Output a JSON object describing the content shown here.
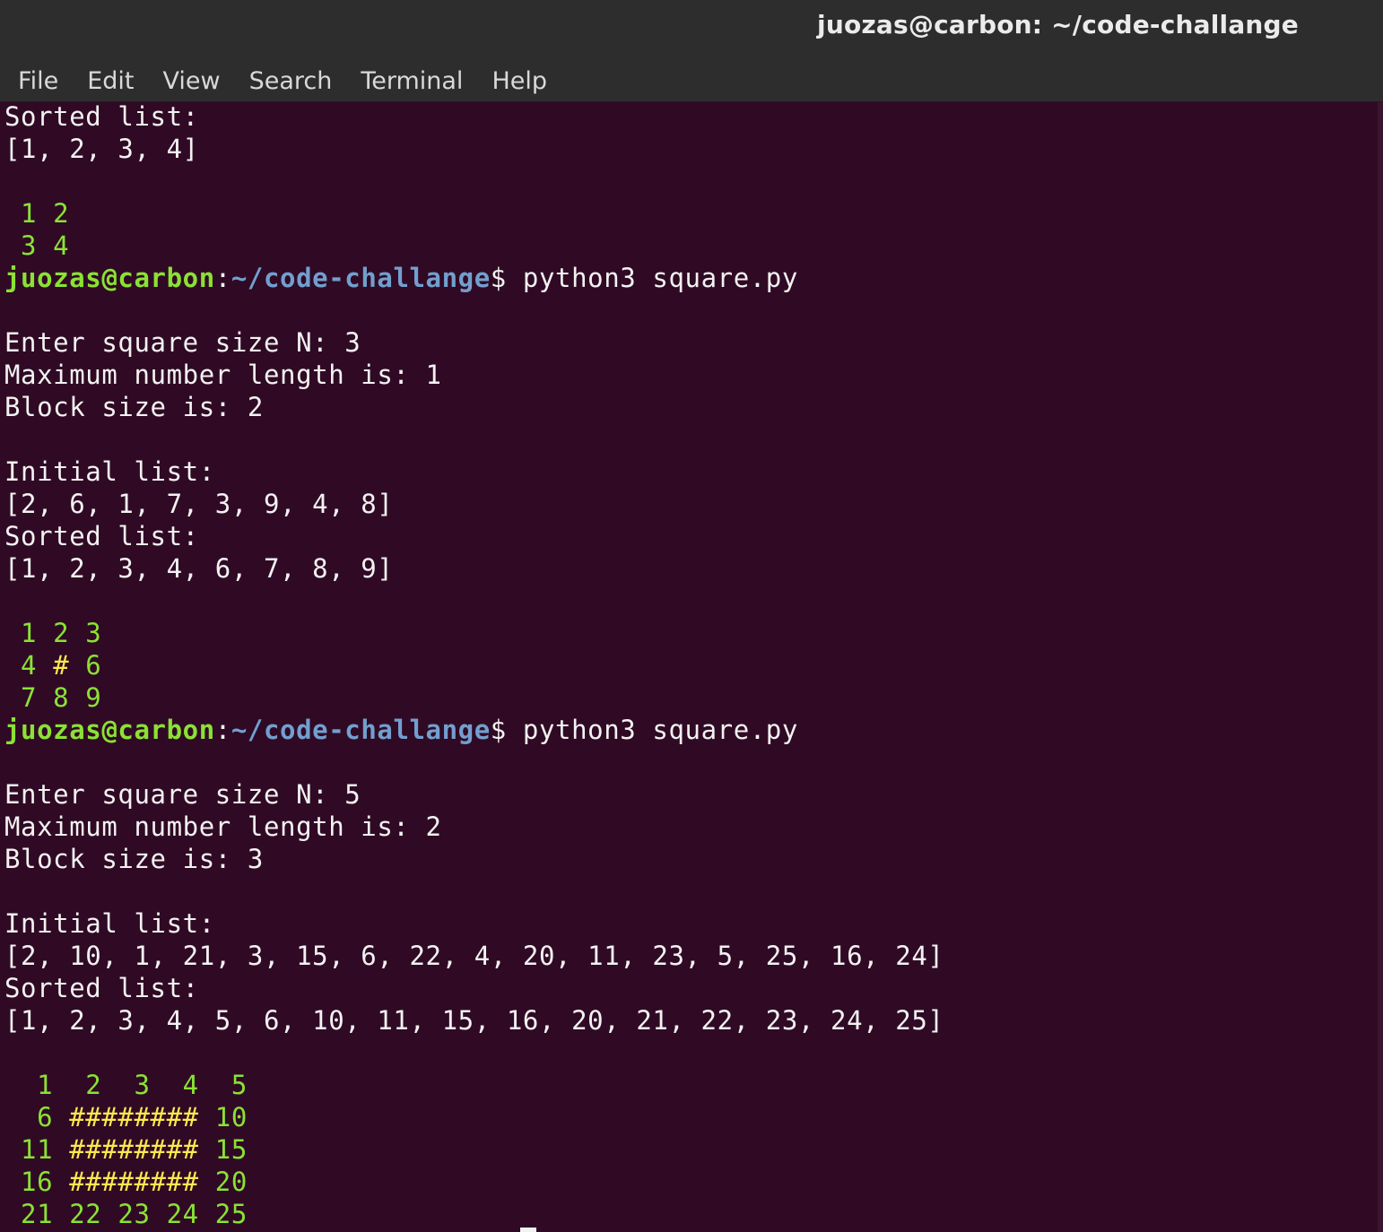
{
  "window": {
    "title": "juozas@carbon: ~/code-challange"
  },
  "menu": [
    "File",
    "Edit",
    "View",
    "Search",
    "Terminal",
    "Help"
  ],
  "prompt": {
    "user_host": "juozas@carbon",
    "colon": ":",
    "path": "~/code-challange",
    "symbol": "$",
    "command": " python3 square.py"
  },
  "colors": {
    "background": "#300a24",
    "prompt_user": "#8ae234",
    "prompt_path": "#729fcf",
    "grid_numbers": "#8ae234",
    "grid_hash": "#fce94f"
  },
  "lines": [
    {
      "segs": [
        {
          "t": "Sorted list:",
          "c": ""
        }
      ]
    },
    {
      "segs": [
        {
          "t": "[1, 2, 3, 4]",
          "c": ""
        }
      ]
    },
    {
      "segs": []
    },
    {
      "segs": [
        {
          "t": " 1 2",
          "c": "g"
        }
      ]
    },
    {
      "segs": [
        {
          "t": " 3 4",
          "c": "g"
        }
      ]
    },
    {
      "prompt": true
    },
    {
      "segs": []
    },
    {
      "segs": [
        {
          "t": "Enter square size N: 3",
          "c": ""
        }
      ]
    },
    {
      "segs": [
        {
          "t": "Maximum number length is: 1",
          "c": ""
        }
      ]
    },
    {
      "segs": [
        {
          "t": "Block size is: 2",
          "c": ""
        }
      ]
    },
    {
      "segs": []
    },
    {
      "segs": [
        {
          "t": "Initial list:",
          "c": ""
        }
      ]
    },
    {
      "segs": [
        {
          "t": "[2, 6, 1, 7, 3, 9, 4, 8]",
          "c": ""
        }
      ]
    },
    {
      "segs": [
        {
          "t": "Sorted list:",
          "c": ""
        }
      ]
    },
    {
      "segs": [
        {
          "t": "[1, 2, 3, 4, 6, 7, 8, 9]",
          "c": ""
        }
      ]
    },
    {
      "segs": []
    },
    {
      "segs": [
        {
          "t": " 1 2 3",
          "c": "g"
        }
      ]
    },
    {
      "segs": [
        {
          "t": " 4 ",
          "c": "g"
        },
        {
          "t": "#",
          "c": "y"
        },
        {
          "t": " 6",
          "c": "g"
        }
      ]
    },
    {
      "segs": [
        {
          "t": " 7 8 9",
          "c": "g"
        }
      ]
    },
    {
      "prompt": true
    },
    {
      "segs": []
    },
    {
      "segs": [
        {
          "t": "Enter square size N: 5",
          "c": ""
        }
      ]
    },
    {
      "segs": [
        {
          "t": "Maximum number length is: 2",
          "c": ""
        }
      ]
    },
    {
      "segs": [
        {
          "t": "Block size is: 3",
          "c": ""
        }
      ]
    },
    {
      "segs": []
    },
    {
      "segs": [
        {
          "t": "Initial list:",
          "c": ""
        }
      ]
    },
    {
      "segs": [
        {
          "t": "[2, 10, 1, 21, 3, 15, 6, 22, 4, 20, 11, 23, 5, 25, 16, 24]",
          "c": ""
        }
      ]
    },
    {
      "segs": [
        {
          "t": "Sorted list:",
          "c": ""
        }
      ]
    },
    {
      "segs": [
        {
          "t": "[1, 2, 3, 4, 5, 6, 10, 11, 15, 16, 20, 21, 22, 23, 24, 25]",
          "c": ""
        }
      ]
    },
    {
      "segs": []
    },
    {
      "segs": [
        {
          "t": "  1  2  3  4  5",
          "c": "g"
        }
      ]
    },
    {
      "segs": [
        {
          "t": "  6 ",
          "c": "g"
        },
        {
          "t": "########",
          "c": "y"
        },
        {
          "t": " 10",
          "c": "g"
        }
      ]
    },
    {
      "segs": [
        {
          "t": " 11 ",
          "c": "g"
        },
        {
          "t": "########",
          "c": "y"
        },
        {
          "t": " 15",
          "c": "g"
        }
      ]
    },
    {
      "segs": [
        {
          "t": " 16 ",
          "c": "g"
        },
        {
          "t": "########",
          "c": "y"
        },
        {
          "t": " 20",
          "c": "g"
        }
      ]
    },
    {
      "segs": [
        {
          "t": " 21 22 23 24 25",
          "c": "g"
        }
      ]
    }
  ]
}
